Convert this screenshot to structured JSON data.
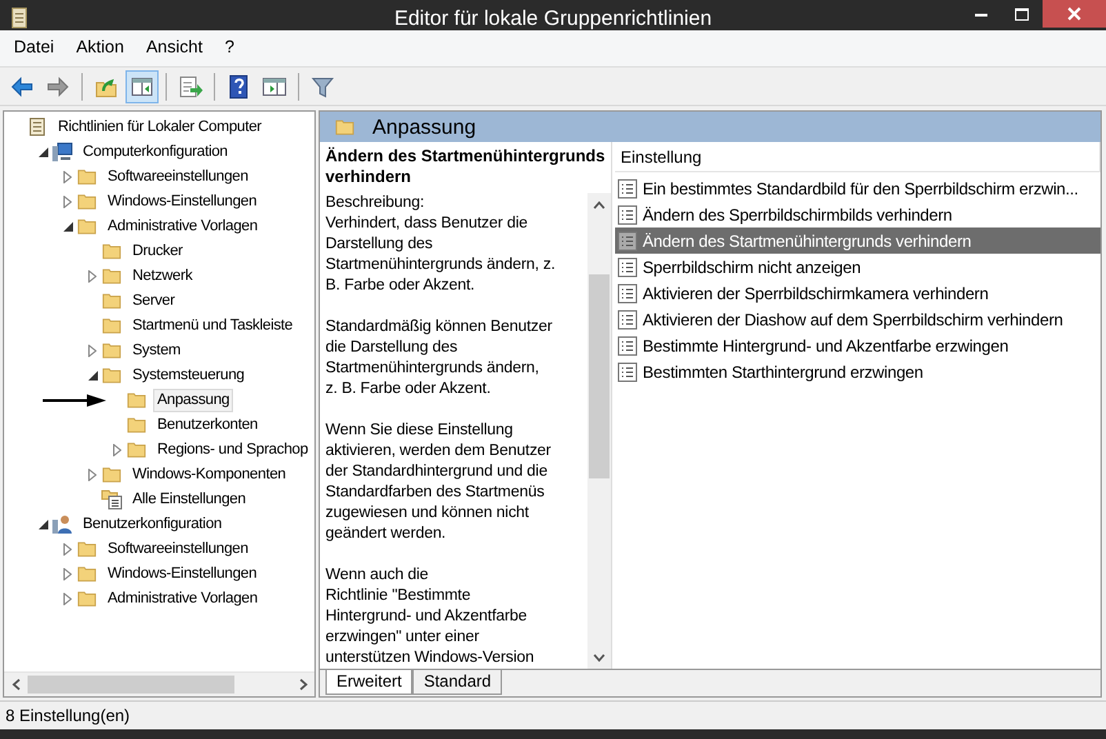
{
  "window": {
    "title": "Editor für lokale Gruppenrichtlinien"
  },
  "menu": [
    "Datei",
    "Aktion",
    "Ansicht",
    "?"
  ],
  "toolbar": [
    {
      "kind": "back",
      "pressed": false
    },
    {
      "kind": "forward",
      "pressed": false
    },
    {
      "kind": "separator"
    },
    {
      "kind": "up",
      "pressed": false
    },
    {
      "kind": "tree",
      "pressed": true
    },
    {
      "kind": "separator"
    },
    {
      "kind": "export",
      "pressed": false
    },
    {
      "kind": "separator"
    },
    {
      "kind": "help",
      "pressed": false
    },
    {
      "kind": "panel",
      "pressed": false
    },
    {
      "kind": "separator"
    },
    {
      "kind": "filter",
      "pressed": false
    }
  ],
  "tree": [
    {
      "label": "Richtlinien für Lokaler Computer",
      "kind": "policy",
      "selected": false,
      "children": [
        {
          "label": "Computerkonfiguration",
          "kind": "computer",
          "selected": false,
          "expanded": true,
          "children": [
            {
              "label": "Softwareeinstellungen",
              "kind": "folder",
              "selected": false,
              "expanded": false
            },
            {
              "label": "Windows-Einstellungen",
              "kind": "folder",
              "selected": false,
              "expanded": false
            },
            {
              "label": "Administrative Vorlagen",
              "kind": "folder",
              "selected": false,
              "expanded": true,
              "children": [
                {
                  "label": "Drucker",
                  "kind": "folder",
                  "selected": false
                },
                {
                  "label": "Netzwerk",
                  "kind": "folder",
                  "selected": false,
                  "expanded": false
                },
                {
                  "label": "Server",
                  "kind": "folder",
                  "selected": false
                },
                {
                  "label": "Startmenü und Taskleiste",
                  "kind": "folder",
                  "selected": false
                },
                {
                  "label": "System",
                  "kind": "folder",
                  "selected": false,
                  "expanded": false
                },
                {
                  "label": "Systemsteuerung",
                  "kind": "folder",
                  "selected": false,
                  "expanded": true,
                  "children": [
                    {
                      "label": "Anpassung",
                      "kind": "folder",
                      "selected": true,
                      "pointed": true
                    },
                    {
                      "label": "Benutzerkonten",
                      "kind": "folder",
                      "selected": false
                    },
                    {
                      "label": "Regions- und Sprachop",
                      "kind": "folder",
                      "selected": false,
                      "expanded": false
                    }
                  ]
                },
                {
                  "label": "Windows-Komponenten",
                  "kind": "folder",
                  "selected": false,
                  "expanded": false
                },
                {
                  "label": "Alle Einstellungen",
                  "kind": "all-settings",
                  "selected": false
                }
              ]
            }
          ]
        },
        {
          "label": "Benutzerkonfiguration",
          "kind": "user",
          "selected": false,
          "expanded": true,
          "children": [
            {
              "label": "Softwareeinstellungen",
              "kind": "folder",
              "selected": false,
              "expanded": false
            },
            {
              "label": "Windows-Einstellungen",
              "kind": "folder",
              "selected": false,
              "expanded": false
            },
            {
              "label": "Administrative Vorlagen",
              "kind": "folder",
              "selected": false,
              "expanded": false
            }
          ]
        }
      ]
    }
  ],
  "details": {
    "header": "Anpassung",
    "title": "Ändern des Startmenühintergrunds verhindern",
    "paragraphs": [
      "Beschreibung:\nVerhindert, dass Benutzer die\nDarstellung des\nStartmenühintergrunds ändern, z.\nB. Farbe oder Akzent.",
      "Standardmäßig können Benutzer\ndie Darstellung des\nStartmenühintergrunds ändern,\nz. B. Farbe oder Akzent.",
      "Wenn Sie diese Einstellung\naktivieren, werden dem Benutzer\nder Standardhintergrund und die\nStandardfarben des Startmenüs\nzugewiesen und können nicht\ngeändert werden.",
      "Wenn auch die\nRichtlinie \"Bestimmte\nHintergrund- und Akzentfarbe\nerzwingen\" unter einer\nunterstützen Windows-Version"
    ]
  },
  "settings": {
    "column": "Einstellung",
    "rows": [
      {
        "name": "Ein bestimmtes Standardbild für den Sperrbildschirm erzwin...",
        "selected": false
      },
      {
        "name": "Ändern des Sperrbildschirmbilds verhindern",
        "selected": false
      },
      {
        "name": "Ändern des Startmenühintergrunds verhindern",
        "selected": true
      },
      {
        "name": "Sperrbildschirm nicht anzeigen",
        "selected": false
      },
      {
        "name": "Aktivieren der Sperrbildschirmkamera verhindern",
        "selected": false
      },
      {
        "name": "Aktivieren der Diashow auf dem Sperrbildschirm verhindern",
        "selected": false
      },
      {
        "name": "Bestimmte Hintergrund- und Akzentfarbe erzwingen",
        "selected": false
      },
      {
        "name": "Bestimmten Starthintergrund erzwingen",
        "selected": false
      }
    ]
  },
  "tabs": [
    {
      "label": "Erweitert",
      "selected": true
    },
    {
      "label": "Standard",
      "selected": false
    }
  ],
  "status_bar": "8 Einstellung(en)"
}
